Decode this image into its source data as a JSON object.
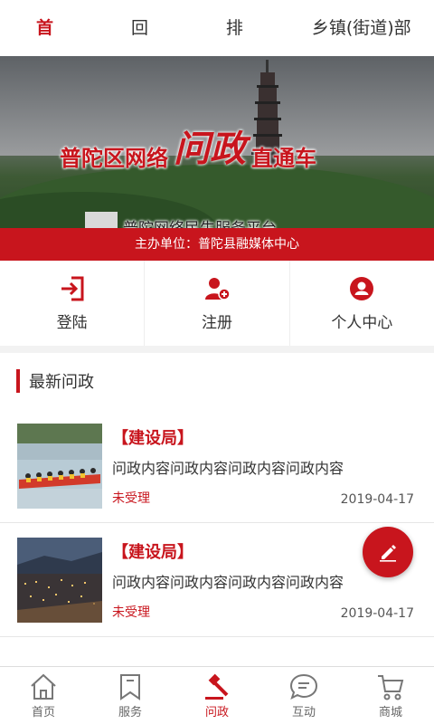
{
  "top_tabs": [
    "首页",
    "回复",
    "排行",
    "乡镇(街道)部门"
  ],
  "active_tab": "首页",
  "banner": {
    "title_prefix": "普陀区网络",
    "title_highlight": "问政",
    "title_suffix": "直通车",
    "subtitle": "普陀网络民生服务平台",
    "host": "主办单位：普陀县融媒体中心"
  },
  "quick_actions": [
    {
      "label": "登陆",
      "icon": "login-icon"
    },
    {
      "label": "注册",
      "icon": "register-icon"
    },
    {
      "label": "个人中心",
      "icon": "user-center-icon"
    }
  ],
  "section": {
    "title": "最新问政"
  },
  "posts": [
    {
      "dept": "【建设局】",
      "content": "问政内容问政内容问政内容问政内容",
      "status": "未受理",
      "date": "2019-04-17",
      "thumb": "dragon-boat-image"
    },
    {
      "dept": "【建设局】",
      "content": "问政内容问政内容问政内容问政内容",
      "status": "未受理",
      "date": "2019-04-17",
      "thumb": "night-city-image"
    }
  ],
  "bottom_nav": [
    {
      "label": "首页",
      "icon": "home-icon"
    },
    {
      "label": "服务",
      "icon": "bookmark-icon"
    },
    {
      "label": "问政",
      "icon": "gavel-icon"
    },
    {
      "label": "互动",
      "icon": "chat-icon"
    },
    {
      "label": "商城",
      "icon": "cart-icon"
    }
  ],
  "active_nav": "问政",
  "colors": {
    "accent": "#c8151d",
    "text": "#333333",
    "muted": "#666666"
  }
}
